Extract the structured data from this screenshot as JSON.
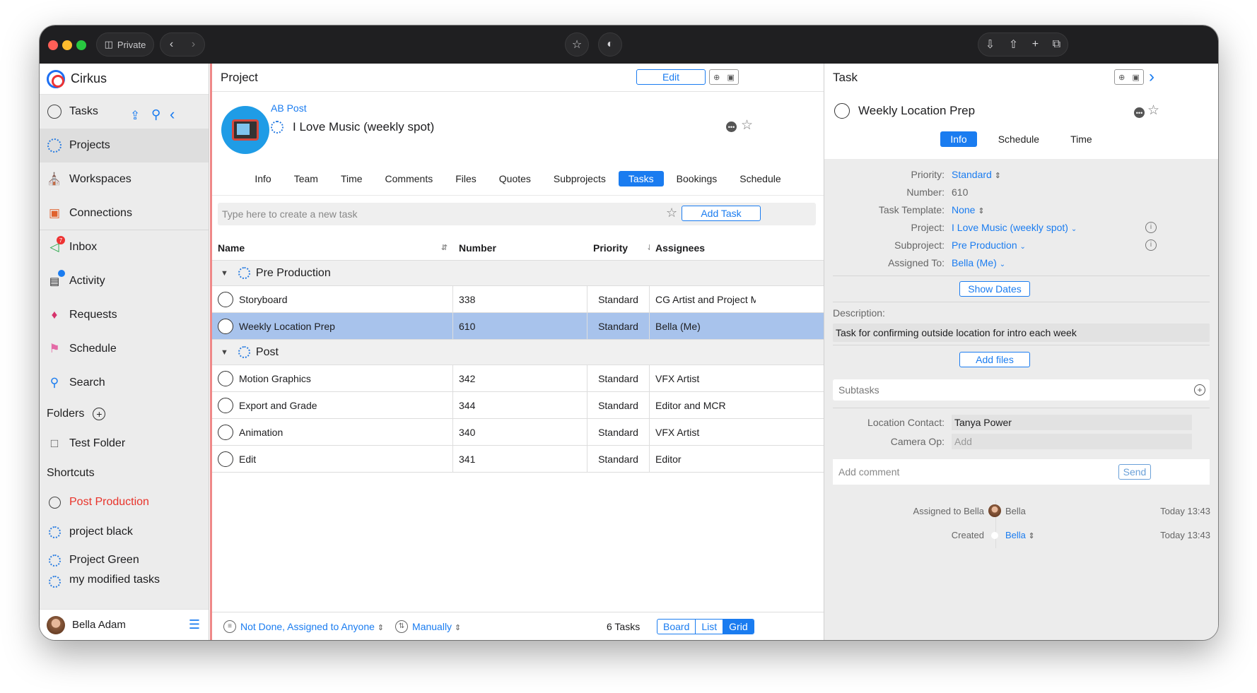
{
  "browser": {
    "private_label": "Private"
  },
  "sidebar": {
    "app_name": "Cirkus",
    "items": [
      {
        "label": "Tasks"
      },
      {
        "label": "Projects"
      },
      {
        "label": "Workspaces"
      },
      {
        "label": "Connections"
      },
      {
        "label": "Inbox",
        "badge": "7"
      },
      {
        "label": "Activity"
      },
      {
        "label": "Requests"
      },
      {
        "label": "Schedule"
      },
      {
        "label": "Search"
      }
    ],
    "folders_header": "Folders",
    "folders": [
      {
        "label": "Test Folder"
      }
    ],
    "shortcuts_header": "Shortcuts",
    "shortcuts": [
      {
        "label": "Post Production",
        "color": "#e8332a"
      },
      {
        "label": "project black"
      },
      {
        "label": "Project Green"
      },
      {
        "label": "my modified tasks"
      }
    ],
    "user_name": "Bella Adam"
  },
  "project": {
    "header_title": "Project",
    "edit_label": "Edit",
    "workspace": "AB Post",
    "name": "I Love Music (weekly spot)",
    "tabs": [
      "Info",
      "Team",
      "Time",
      "Comments",
      "Files",
      "Quotes",
      "Subprojects",
      "Tasks",
      "Bookings",
      "Schedule"
    ],
    "active_tab": "Tasks",
    "new_task_placeholder": "Type here to create a new task",
    "add_task_label": "Add Task",
    "columns": {
      "name": "Name",
      "number": "Number",
      "priority": "Priority",
      "assignees": "Assignees"
    },
    "groups": [
      {
        "title": "Pre Production",
        "rows": [
          {
            "name": "Storyboard",
            "number": "338",
            "priority": "Standard",
            "assignees": "CG Artist and Project Manager"
          },
          {
            "name": "Weekly Location Prep",
            "number": "610",
            "priority": "Standard",
            "assignees": "Bella (Me)"
          }
        ]
      },
      {
        "title": "Post",
        "rows": [
          {
            "name": "Motion Graphics",
            "number": "342",
            "priority": "Standard",
            "assignees": "VFX Artist"
          },
          {
            "name": "Export and Grade",
            "number": "344",
            "priority": "Standard",
            "assignees": "Editor and MCR"
          },
          {
            "name": "Animation",
            "number": "340",
            "priority": "Standard",
            "assignees": "VFX Artist"
          },
          {
            "name": "Edit",
            "number": "341",
            "priority": "Standard",
            "assignees": "Editor"
          }
        ]
      }
    ],
    "footer": {
      "filter": "Not Done, Assigned to Anyone",
      "sort": "Manually",
      "count": "6 Tasks",
      "views": [
        "Board",
        "List",
        "Grid"
      ],
      "active_view": "Grid"
    }
  },
  "task": {
    "header_title": "Task",
    "name": "Weekly Location Prep",
    "tabs": [
      "Info",
      "Schedule",
      "Time"
    ],
    "active_tab": "Info",
    "fields": {
      "priority_label": "Priority:",
      "priority": "Standard",
      "number_label": "Number:",
      "number": "610",
      "template_label": "Task Template:",
      "template": "None",
      "project_label": "Project:",
      "project": "I Love Music (weekly spot)",
      "subproject_label": "Subproject:",
      "subproject": "Pre Production",
      "assigned_label": "Assigned To:",
      "assigned": "Bella (Me)"
    },
    "show_dates_label": "Show Dates",
    "description_label": "Description:",
    "description": "Task for confirming outside location for intro each week",
    "add_files_label": "Add files",
    "subtasks_label": "Subtasks",
    "location_contact_label": "Location Contact:",
    "location_contact": "Tanya Power",
    "camera_op_label": "Camera Op:",
    "camera_op_placeholder": "Add",
    "comment_placeholder": "Add comment",
    "send_label": "Send",
    "activity": [
      {
        "text": "Assigned to Bella",
        "user": "Bella",
        "time": "Today 13:43"
      },
      {
        "text": "Created",
        "user": "Bella",
        "time": "Today 13:43"
      }
    ]
  }
}
